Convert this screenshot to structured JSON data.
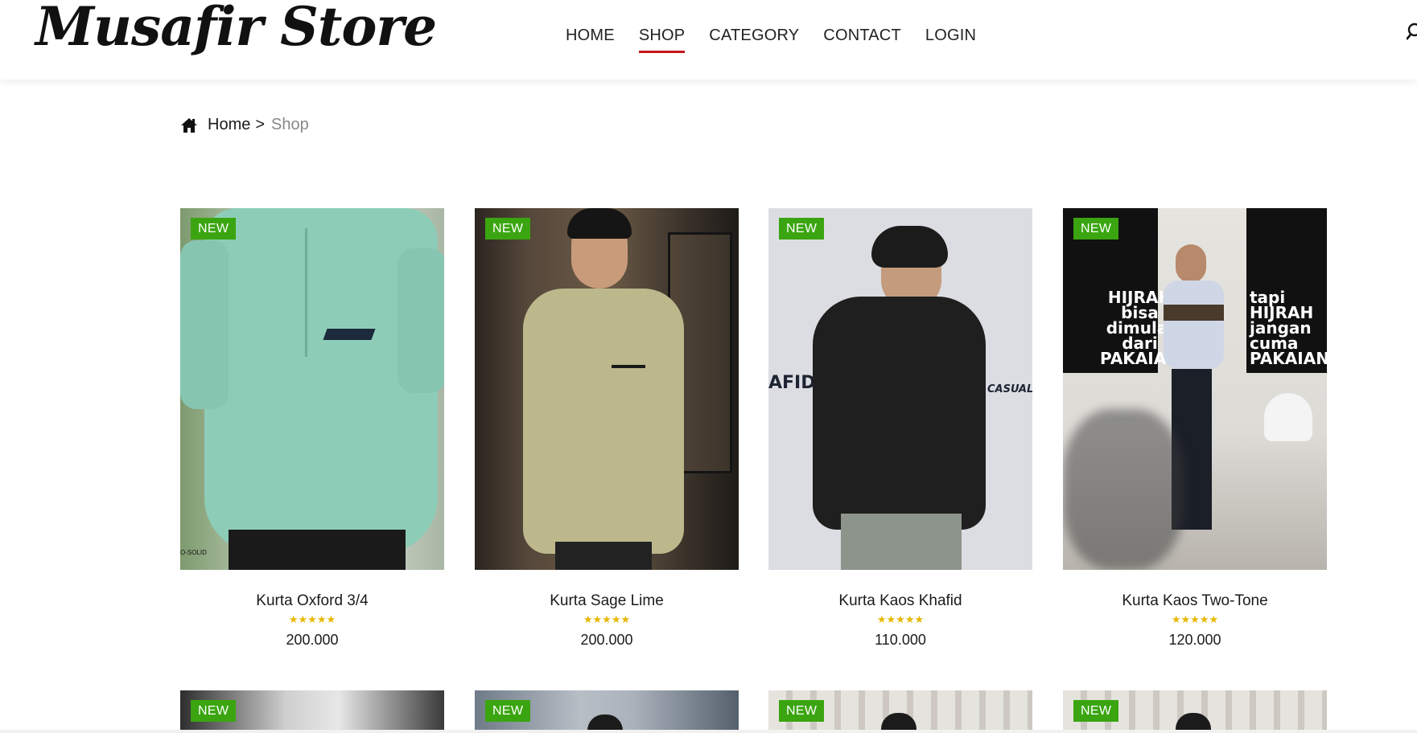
{
  "header": {
    "logo": "Musafir Store",
    "nav": [
      {
        "label": "HOME",
        "active": false
      },
      {
        "label": "SHOP",
        "active": true
      },
      {
        "label": "CATEGORY",
        "active": false
      },
      {
        "label": "CONTACT",
        "active": false
      },
      {
        "label": "LOGIN",
        "active": false
      }
    ],
    "accent_color": "#c4161c"
  },
  "breadcrumb": {
    "home": "Home",
    "separator": ">",
    "current": "Shop"
  },
  "products": [
    {
      "badge": "NEW",
      "name": "Kurta Oxford 3/4",
      "rating": 5,
      "stars": "★★★★★",
      "price": "200.000",
      "image_text": "O-SOLID"
    },
    {
      "badge": "NEW",
      "name": "Kurta Sage Lime",
      "rating": 5,
      "stars": "★★★★★",
      "price": "200.000"
    },
    {
      "badge": "NEW",
      "name": "Kurta Kaos Khafid",
      "rating": 5,
      "stars": "★★★★★",
      "price": "110.000",
      "image_text_left": "AFID",
      "image_text_right": "CASUAL"
    },
    {
      "badge": "NEW",
      "name": "Kurta Kaos Two-Tone",
      "rating": 5,
      "stars": "★★★★★",
      "price": "120.000",
      "wall_text_left": [
        "HIJRAH",
        "bisa",
        "dimulai",
        "dari",
        "PAKAIAN"
      ],
      "wall_text_right": [
        "tapi",
        "HIJRAH",
        "jangan",
        "cuma",
        "PAKAIAN·"
      ]
    }
  ],
  "products_row2": [
    {
      "badge": "NEW"
    },
    {
      "badge": "NEW"
    },
    {
      "badge": "NEW"
    },
    {
      "badge": "NEW"
    }
  ],
  "colors": {
    "badge": "#3aa510",
    "stars": "#e6b800"
  }
}
